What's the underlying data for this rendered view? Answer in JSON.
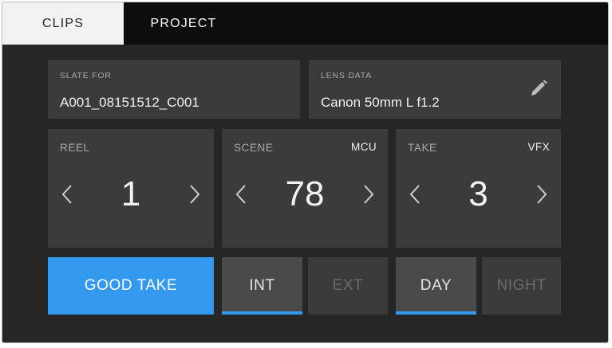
{
  "tabs": [
    {
      "label": "CLIPS",
      "active": true
    },
    {
      "label": "PROJECT",
      "active": false
    }
  ],
  "slate": {
    "label": "SLATE FOR",
    "value": "A001_08151512_C001"
  },
  "lens": {
    "label": "LENS DATA",
    "value": "Canon 50mm L f1.2",
    "icon": "pencil-icon"
  },
  "reel": {
    "label": "REEL",
    "value": "1"
  },
  "scene": {
    "label": "SCENE",
    "tag": "MCU",
    "value": "78"
  },
  "take": {
    "label": "TAKE",
    "tag": "VFX",
    "value": "3"
  },
  "buttons": {
    "good_take": "GOOD TAKE",
    "int": "INT",
    "ext": "EXT",
    "day": "DAY",
    "night": "NIGHT"
  },
  "colors": {
    "accent": "#3399ee",
    "panel": "#3b3b3b",
    "background": "#262626"
  }
}
